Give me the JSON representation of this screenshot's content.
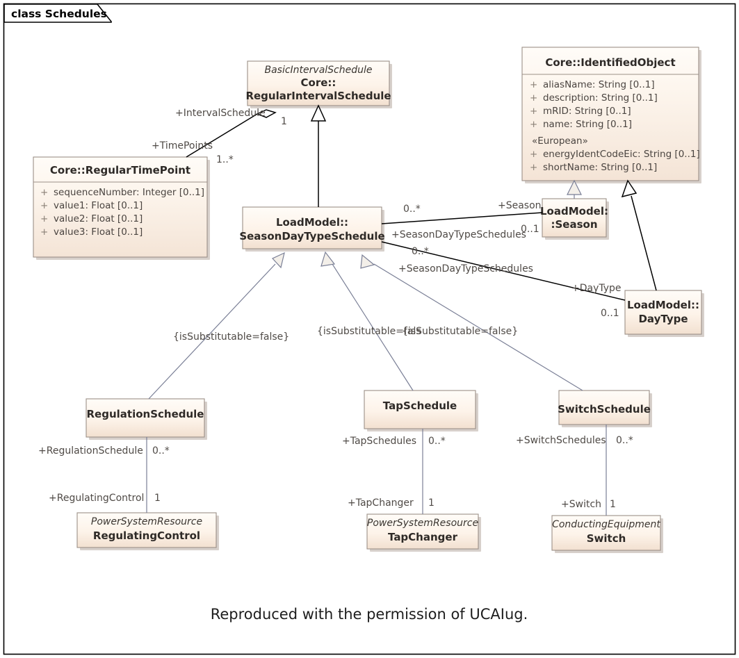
{
  "frame": {
    "label": "class Schedules",
    "caption": "Reproduced with the permission of UCAIug."
  },
  "colors": {
    "box_fill_top": "#fffaf4",
    "box_fill_bottom": "#f3e2d3",
    "box_border": "#9b8f87",
    "link_black": "#000000",
    "link_grey": "#7a7f96",
    "text": "#4a4440",
    "frame_border": "#000000"
  },
  "classes": {
    "regular_interval_schedule": {
      "parent": "BasicIntervalSchedule",
      "name_line1": "Core::",
      "name_line2": "RegularIntervalSchedule"
    },
    "identified_object": {
      "name": "Core::IdentifiedObject",
      "attributes": [
        {
          "visibility": "+",
          "text": "aliasName: String [0..1]"
        },
        {
          "visibility": "+",
          "text": "description: String [0..1]"
        },
        {
          "visibility": "+",
          "text": "mRID: String [0..1]"
        },
        {
          "visibility": "+",
          "text": "name: String [0..1]"
        }
      ],
      "stereotype": "«European»",
      "stereotype_attributes": [
        {
          "visibility": "+",
          "text": "energyIdentCodeEic: String [0..1]"
        },
        {
          "visibility": "+",
          "text": "shortName: String [0..1]"
        }
      ]
    },
    "regular_time_point": {
      "name": "Core::RegularTimePoint",
      "attributes": [
        {
          "visibility": "+",
          "text": "sequenceNumber: Integer [0..1]"
        },
        {
          "visibility": "+",
          "text": "value1: Float [0..1]"
        },
        {
          "visibility": "+",
          "text": "value2: Float [0..1]"
        },
        {
          "visibility": "+",
          "text": "value3: Float [0..1]"
        }
      ]
    },
    "season_day_type_schedule": {
      "name_line1": "LoadModel::",
      "name_line2": "SeasonDayTypeSchedule"
    },
    "season": {
      "name_line1": "LoadModel:",
      "name_line2": ":Season"
    },
    "day_type": {
      "name_line1": "LoadModel::",
      "name_line2": "DayType"
    },
    "regulation_schedule": {
      "name": "RegulationSchedule"
    },
    "tap_schedule": {
      "name": "TapSchedule"
    },
    "switch_schedule": {
      "name": "SwitchSchedule"
    },
    "regulating_control": {
      "parent": "PowerSystemResource",
      "name": "RegulatingControl"
    },
    "tap_changer": {
      "parent": "PowerSystemResource",
      "name": "TapChanger"
    },
    "switch": {
      "parent": "ConductingEquipment",
      "name": "Switch"
    }
  },
  "associations": {
    "interval_schedule_timepoints": {
      "role_target": "+IntervalSchedule",
      "mult_target": "1",
      "role_source": "+TimePoints",
      "mult_source": "1..*"
    },
    "schedule_season": {
      "role_source": "+SeasonDayTypeSchedules",
      "mult_source": "0..*",
      "role_target": "+Season",
      "mult_target": "0..1"
    },
    "schedule_daytype": {
      "role_source": "+SeasonDayTypeSchedules",
      "mult_source": "0..*",
      "role_target": "+DayType",
      "mult_target": "0..1"
    },
    "regulation_control": {
      "role_source": "+RegulationSchedule",
      "mult_source": "0..*",
      "role_target": "+RegulatingControl",
      "mult_target": "1"
    },
    "tap_changer": {
      "role_source": "+TapSchedules",
      "mult_source": "0..*",
      "role_target": "+TapChanger",
      "mult_target": "1"
    },
    "switch": {
      "role_source": "+SwitchSchedules",
      "mult_source": "0..*",
      "role_target": "+Switch",
      "mult_target": "1"
    }
  },
  "constraints": {
    "regulation": "{isSubstitutable=false}",
    "tap": "{isSubstitutable=fals",
    "switch": "{isSubstitutable=false}"
  }
}
